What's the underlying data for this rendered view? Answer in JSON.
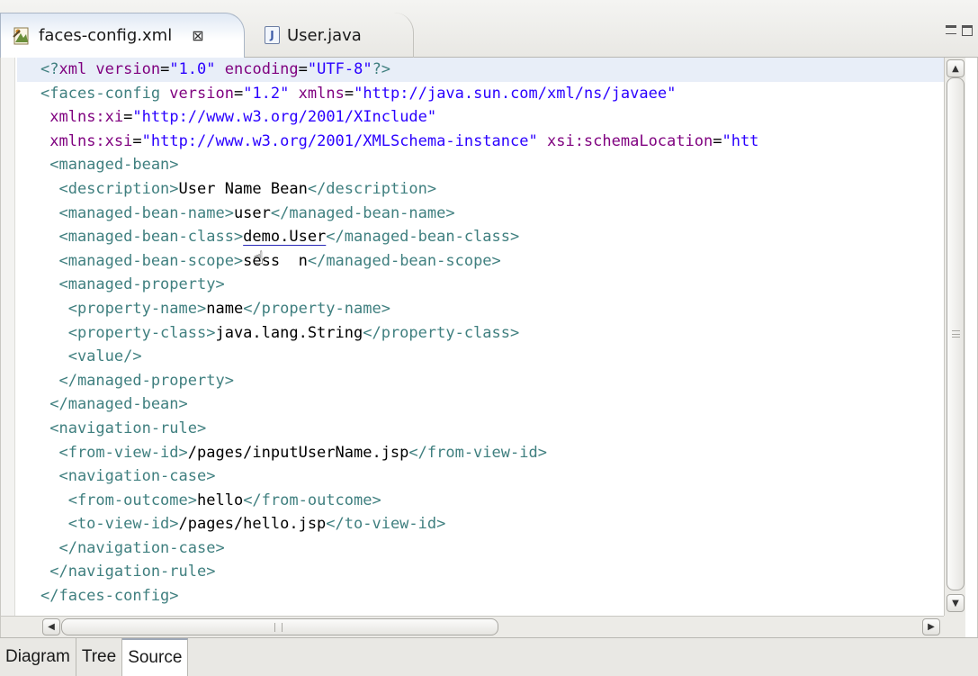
{
  "tabs": [
    {
      "label": "faces-config.xml",
      "close": "⊠",
      "icon": "xml-file-icon",
      "active": true
    },
    {
      "label": "User.java",
      "icon": "java-file-icon",
      "active": false
    }
  ],
  "editor": {
    "lines": [
      [
        [
          "tg",
          "<?"
        ],
        [
          "an",
          "xml version"
        ],
        [
          "tx",
          "="
        ],
        [
          "av",
          "\"1.0\""
        ],
        [
          "tx",
          " "
        ],
        [
          "an",
          "encoding"
        ],
        [
          "tx",
          "="
        ],
        [
          "av",
          "\"UTF-8\""
        ],
        [
          "tg",
          "?>"
        ]
      ],
      [
        [
          "tg",
          "<faces-config "
        ],
        [
          "an",
          "version"
        ],
        [
          "tx",
          "="
        ],
        [
          "av",
          "\"1.2\""
        ],
        [
          "tx",
          " "
        ],
        [
          "an",
          "xmlns"
        ],
        [
          "tx",
          "="
        ],
        [
          "av",
          "\"http://java.sun.com/xml/ns/javaee\""
        ]
      ],
      [
        [
          "tx",
          " "
        ],
        [
          "an",
          "xmlns:xi"
        ],
        [
          "tx",
          "="
        ],
        [
          "av",
          "\"http://www.w3.org/2001/XInclude\""
        ]
      ],
      [
        [
          "tx",
          " "
        ],
        [
          "an",
          "xmlns:xsi"
        ],
        [
          "tx",
          "="
        ],
        [
          "av",
          "\"http://www.w3.org/2001/XMLSchema-instance\""
        ],
        [
          "tx",
          " "
        ],
        [
          "an",
          "xsi:schemaLocation"
        ],
        [
          "tx",
          "="
        ],
        [
          "av",
          "\"htt"
        ]
      ],
      [
        [
          "tg",
          " <managed-bean>"
        ]
      ],
      [
        [
          "tg",
          "  <description>"
        ],
        [
          "tx",
          "User Name Bean"
        ],
        [
          "tg",
          "</description>"
        ]
      ],
      [
        [
          "tg",
          "  <managed-bean-name>"
        ],
        [
          "tx",
          "user"
        ],
        [
          "tg",
          "</managed-bean-name>"
        ]
      ],
      [
        [
          "tg",
          "  <managed-bean-class>"
        ],
        [
          "hl",
          "demo.User"
        ],
        [
          "tg",
          "</managed-bean-class>"
        ]
      ],
      [
        [
          "tg",
          "  <managed-bean-scope>"
        ],
        [
          "tx",
          "sess"
        ],
        [
          "cur",
          ""
        ],
        [
          "tx",
          "  n"
        ],
        [
          "tg",
          "</managed-bean-scope>"
        ]
      ],
      [
        [
          "tg",
          "  <managed-property>"
        ]
      ],
      [
        [
          "tg",
          "   <property-name>"
        ],
        [
          "tx",
          "name"
        ],
        [
          "tg",
          "</property-name>"
        ]
      ],
      [
        [
          "tg",
          "   <property-class>"
        ],
        [
          "tx",
          "java.lang.String"
        ],
        [
          "tg",
          "</property-class>"
        ]
      ],
      [
        [
          "tg",
          "   <value/>"
        ]
      ],
      [
        [
          "tg",
          "  </managed-property>"
        ]
      ],
      [
        [
          "tg",
          " </managed-bean>"
        ]
      ],
      [
        [
          "tg",
          " <navigation-rule>"
        ]
      ],
      [
        [
          "tg",
          "  <from-view-id>"
        ],
        [
          "tx",
          "/pages/inputUserName.jsp"
        ],
        [
          "tg",
          "</from-view-id>"
        ]
      ],
      [
        [
          "tg",
          "  <navigation-case>"
        ]
      ],
      [
        [
          "tg",
          "   <from-outcome>"
        ],
        [
          "tx",
          "hello"
        ],
        [
          "tg",
          "</from-outcome>"
        ]
      ],
      [
        [
          "tg",
          "   <to-view-id>"
        ],
        [
          "tx",
          "/pages/hello.jsp"
        ],
        [
          "tg",
          "</to-view-id>"
        ]
      ],
      [
        [
          "tg",
          "  </navigation-case>"
        ]
      ],
      [
        [
          "tg",
          " </navigation-rule>"
        ]
      ],
      [
        [
          "tg",
          "</faces-config>"
        ]
      ]
    ]
  },
  "bottom_tabs": [
    {
      "label": "Diagram",
      "active": false
    },
    {
      "label": "Tree",
      "active": false
    },
    {
      "label": "Source",
      "active": true
    }
  ],
  "colors": {
    "tag": "#3f7f7f",
    "attr_name": "#7f007f",
    "attr_value": "#2a00ff",
    "text": "#000000"
  }
}
